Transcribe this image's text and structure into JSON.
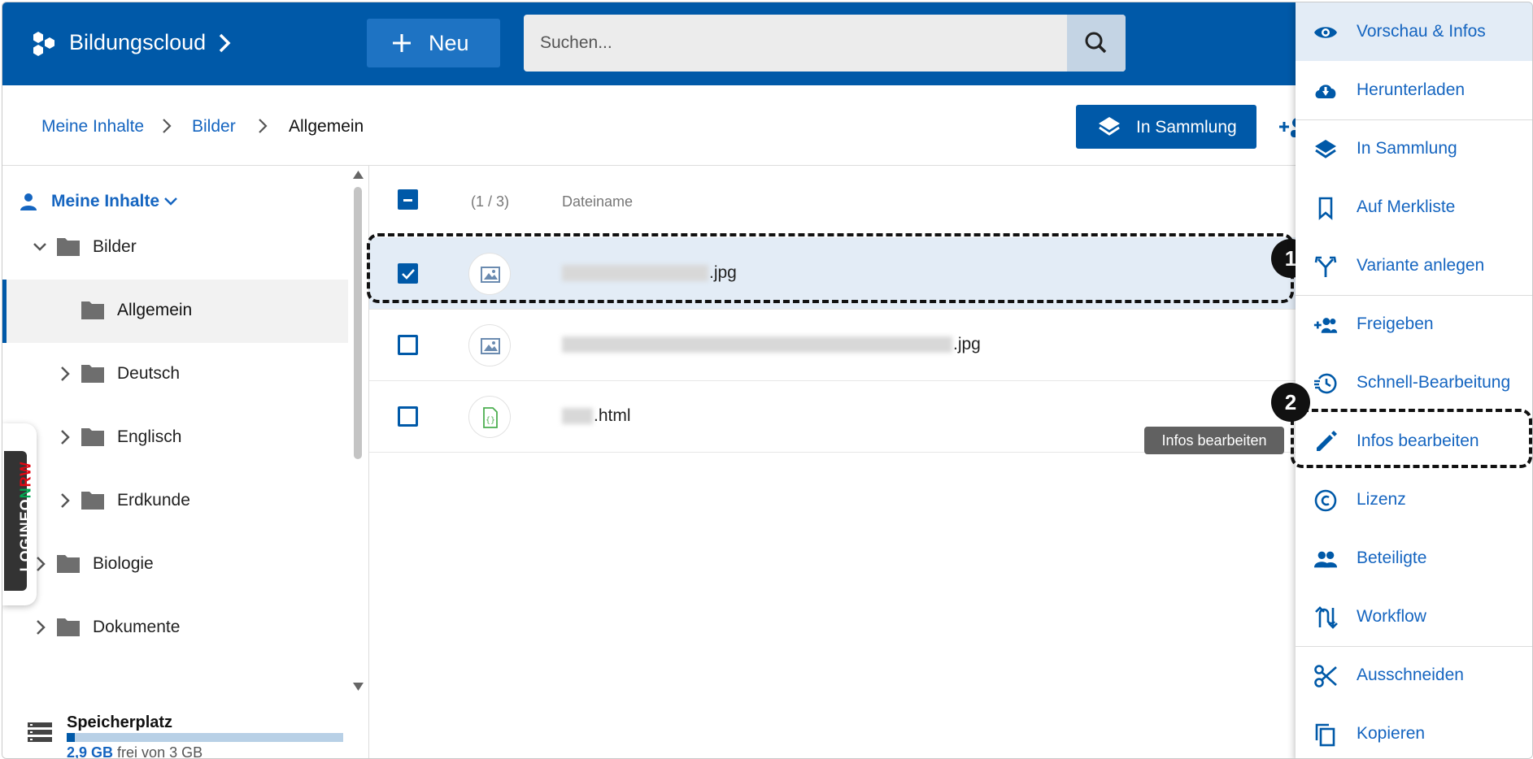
{
  "header": {
    "app_name": "Bildungscloud",
    "new_label": "Neu",
    "search_placeholder": "Suchen..."
  },
  "breadcrumb": [
    "Meine Inhalte",
    "Bilder",
    "Allgemein"
  ],
  "toolbar": {
    "collection_label": "In Sammlung"
  },
  "sidebar": {
    "root_label": "Meine Inhalte",
    "items": [
      {
        "label": "Bilder",
        "expanded": true,
        "level": 0
      },
      {
        "label": "Allgemein",
        "active": true,
        "level": 1
      },
      {
        "label": "Deutsch",
        "level": 1
      },
      {
        "label": "Englisch",
        "level": 1
      },
      {
        "label": "Erdkunde",
        "level": 1
      },
      {
        "label": "Biologie",
        "level": 0
      },
      {
        "label": "Dokumente",
        "level": 0
      }
    ],
    "badge": {
      "part1": "LOGINEO",
      "part2": "N",
      "part3": "RW"
    },
    "storage": {
      "title": "Speicherplatz",
      "used": "2,9 GB",
      "rest": "frei von 3 GB",
      "used_fraction": 0.03
    }
  },
  "filelist": {
    "count": "(1 / 3)",
    "column_name": "Dateiname",
    "rows": [
      {
        "ext": ".jpg",
        "selected": true,
        "icon": "image-icon"
      },
      {
        "ext": ".jpg",
        "selected": false,
        "icon": "image-icon"
      },
      {
        "ext": ".html",
        "selected": false,
        "icon": "code-file-icon"
      }
    ]
  },
  "menu": {
    "items": [
      {
        "label": "Vorschau & Infos",
        "icon": "eye-icon"
      },
      {
        "label": "Herunterladen",
        "icon": "cloud-download-icon"
      },
      {
        "label": "In Sammlung",
        "icon": "layers-icon"
      },
      {
        "label": "Auf Merkliste",
        "icon": "bookmark-icon"
      },
      {
        "label": "Variante anlegen",
        "icon": "fork-icon"
      },
      {
        "label": "Freigeben",
        "icon": "share-users-icon"
      },
      {
        "label": "Schnell-Bearbeitung",
        "icon": "history-icon"
      },
      {
        "label": "Infos bearbeiten",
        "icon": "pencil-icon"
      },
      {
        "label": "Lizenz",
        "icon": "copyright-icon"
      },
      {
        "label": "Beteiligte",
        "icon": "people-icon"
      },
      {
        "label": "Workflow",
        "icon": "workflow-icon"
      },
      {
        "label": "Ausschneiden",
        "icon": "scissors-icon"
      },
      {
        "label": "Kopieren",
        "icon": "copy-icon"
      }
    ]
  },
  "tooltip": "Infos bearbeiten",
  "annotations": [
    "1",
    "2"
  ],
  "colors": {
    "brand": "#0059a8",
    "link": "#1565c0",
    "selected_row": "#e3ecf6"
  }
}
